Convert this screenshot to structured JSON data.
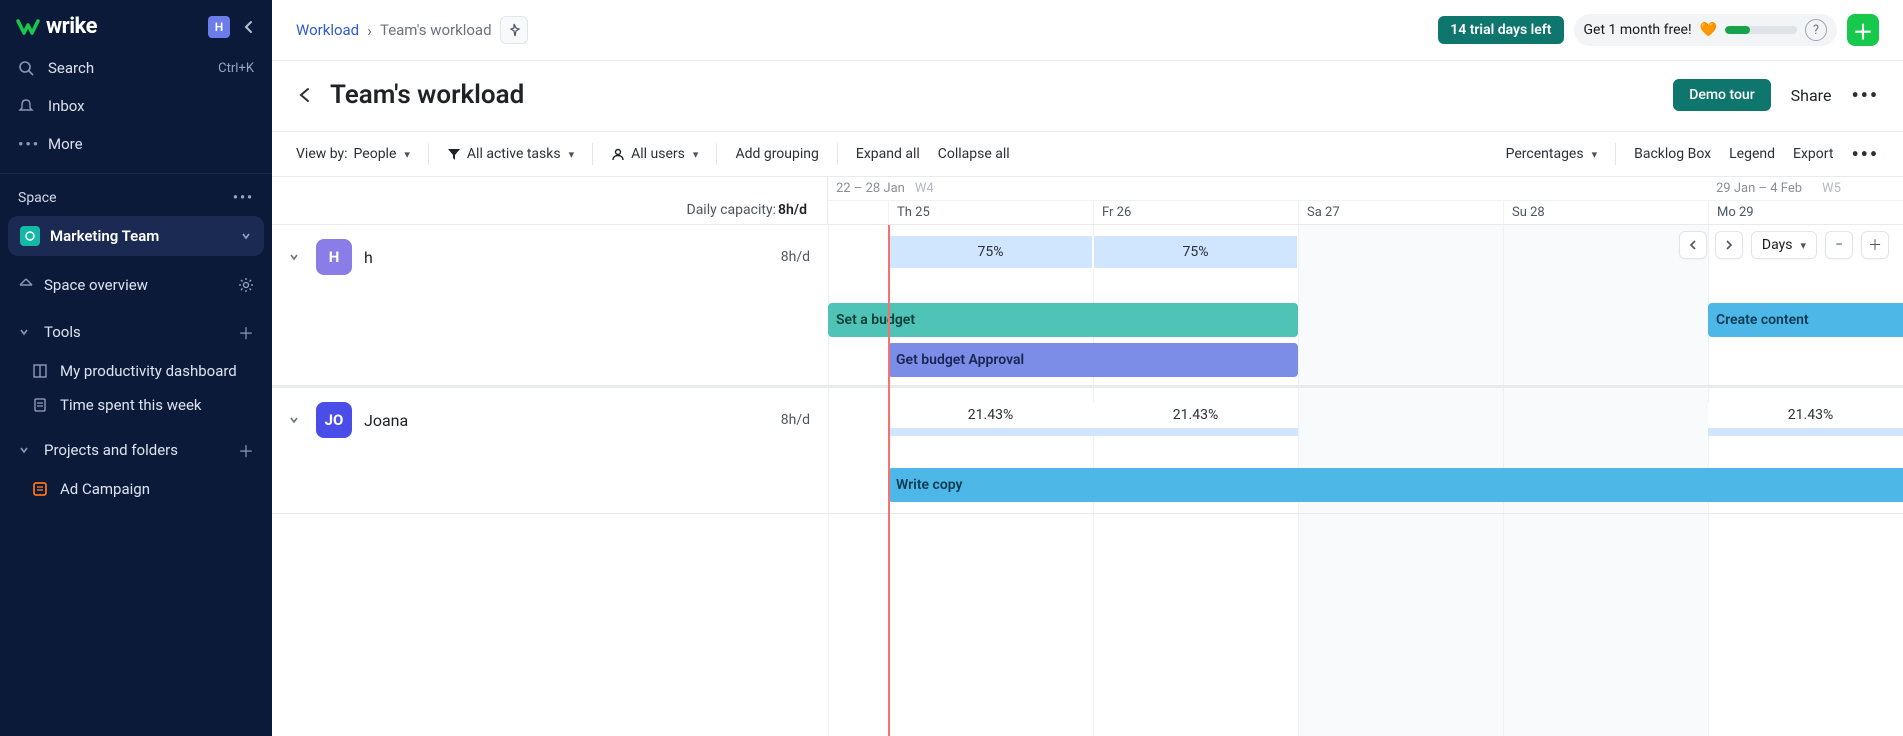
{
  "brand": "wrike",
  "user_avatar_letter": "H",
  "sidebar": {
    "search_label": "Search",
    "search_kbd": "Ctrl+K",
    "inbox_label": "Inbox",
    "more_label": "More",
    "space_header": "Space",
    "space_name": "Marketing Team",
    "space_overview": "Space overview",
    "tools_label": "Tools",
    "tool1": "My productivity dashboard",
    "tool2": "Time spent this week",
    "projects_label": "Projects and folders",
    "project1": "Ad Campaign"
  },
  "breadcrumbs": {
    "root": "Workload",
    "current": "Team's workload"
  },
  "trial_badge": "14 trial days left",
  "month_free": "Get 1 month free!",
  "page_title": "Team's workload",
  "demo_tour": "Demo tour",
  "share_label": "Share",
  "toolbar": {
    "viewby_label": "View by: ",
    "viewby_value": "People",
    "filter_label": "All active tasks",
    "users_label": "All users",
    "add_grouping": "Add grouping",
    "expand_all": "Expand all",
    "collapse_all": "Collapse all",
    "percentages": "Percentages",
    "backlog_box": "Backlog Box",
    "legend": "Legend",
    "export": "Export"
  },
  "daily_capacity_label": "Daily capacity: ",
  "daily_capacity_value": "8h/d",
  "timeline": {
    "week1_range": "22 – 28 Jan",
    "week1_num": "W4",
    "week2_range": "29 Jan – 4 Feb",
    "week2_num": "W5",
    "days": [
      "Th 25",
      "Fr 26",
      "Sa 27",
      "Su 28",
      "Mo 29"
    ],
    "zoom": "Days"
  },
  "people": [
    {
      "initial": "H",
      "name": "h",
      "daily": "8h/d",
      "avatar_bg": "#8a7de8",
      "loads": [
        "75%",
        "75%"
      ],
      "tasks": [
        {
          "name": "Set a budget",
          "color": "teal"
        },
        {
          "name": "Get budget Approval",
          "color": "blue"
        },
        {
          "name": "Create content",
          "color": "sky"
        }
      ]
    },
    {
      "initial": "JO",
      "name": "Joana",
      "daily": "8h/d",
      "avatar_bg": "#4b4de8",
      "loads": [
        "21.43%",
        "21.43%",
        "21.43%"
      ],
      "tasks": [
        {
          "name": "Write copy",
          "color": "sky"
        }
      ]
    }
  ]
}
